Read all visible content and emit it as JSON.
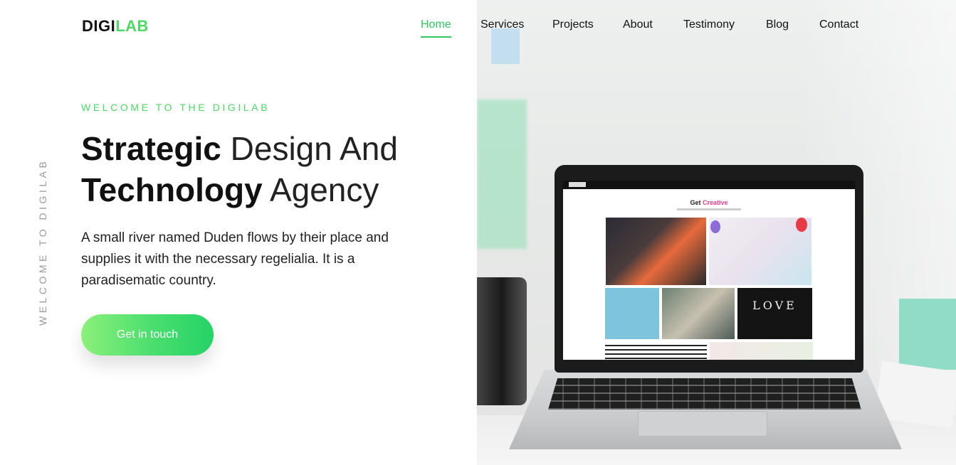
{
  "brand": {
    "logo_part1": "DIGI",
    "logo_part2": "LAB"
  },
  "nav": {
    "items": [
      {
        "label": "Home",
        "active": true
      },
      {
        "label": "Services",
        "active": false
      },
      {
        "label": "Projects",
        "active": false
      },
      {
        "label": "About",
        "active": false
      },
      {
        "label": "Testimony",
        "active": false
      },
      {
        "label": "Blog",
        "active": false
      },
      {
        "label": "Contact",
        "active": false
      }
    ]
  },
  "hero": {
    "vertical_text": "WELCOME TO DIGILAB",
    "kicker": "WELCOME TO THE DIGILAB",
    "headline_line1_bold": "Strategic",
    "headline_line1_rest": " Design And",
    "headline_line2_bold": "Technology",
    "headline_line2_rest": " Agency",
    "description": "A small river named Duden flows by their place and supplies it with the necessary regelialia. It is a paradisematic country.",
    "cta_label": "Get in touch"
  },
  "laptop_screen": {
    "heading_plain": "Get ",
    "heading_accent": "Creative",
    "tile_text": "LOVE"
  },
  "colors": {
    "accent": "#4cd964",
    "nav_active": "#2ec760",
    "text": "#111111"
  }
}
